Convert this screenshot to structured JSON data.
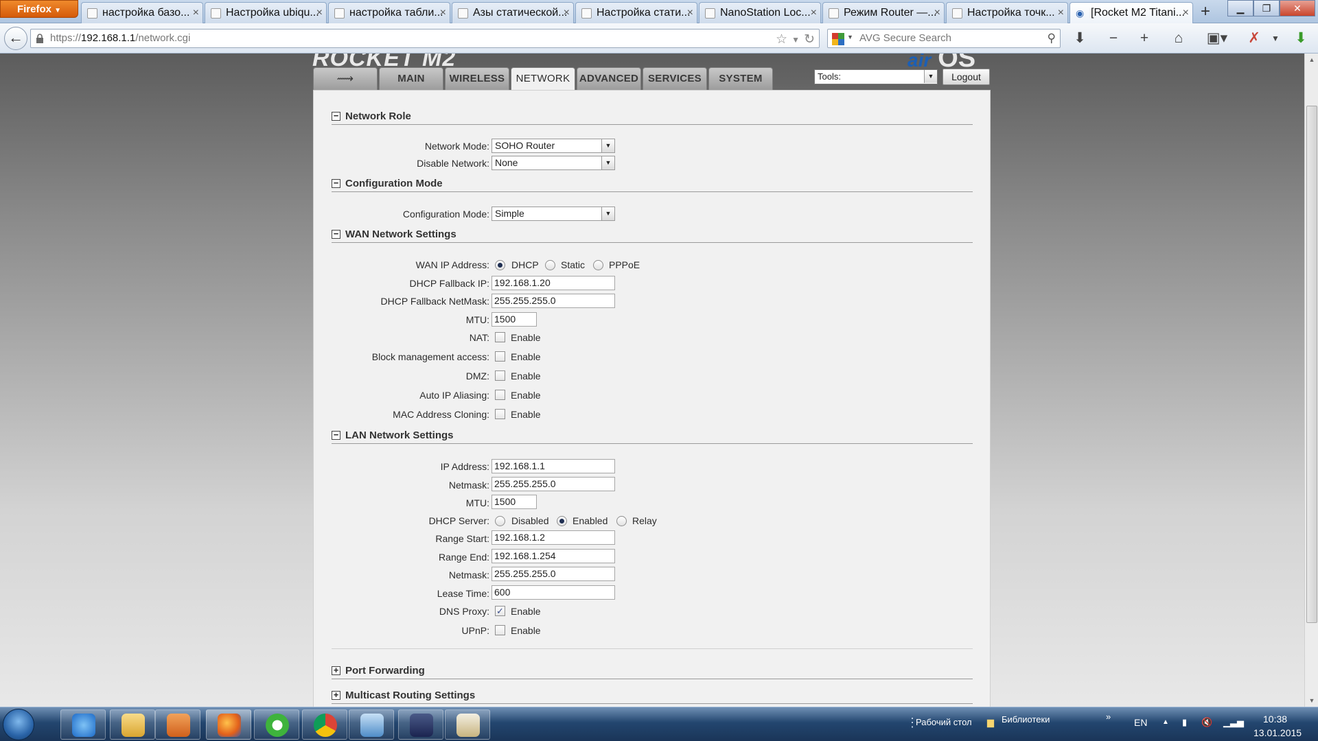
{
  "browser": {
    "menu_button": "Firefox",
    "tabs": [
      {
        "label": "настройка базо..."
      },
      {
        "label": "Настройка ubiqu..."
      },
      {
        "label": "настройка табли..."
      },
      {
        "label": "Азы статической..."
      },
      {
        "label": "Настройка стати..."
      },
      {
        "label": "NanoStation Loc..."
      },
      {
        "label": "Режим Router —..."
      },
      {
        "label": "Настройка точк..."
      },
      {
        "label": "[Rocket M2 Titani..."
      }
    ],
    "url_prefix": "https://",
    "url_host": "192.168.1.1",
    "url_path": "/network.cgi",
    "search_placeholder": "AVG Secure Search"
  },
  "page": {
    "nav_tabs": [
      "MAIN",
      "WIRELESS",
      "NETWORK",
      "ADVANCED",
      "SERVICES",
      "SYSTEM"
    ],
    "active_tab": "NETWORK",
    "tools_select": "Tools:",
    "logout": "Logout",
    "sections": {
      "network_role": "Network Role",
      "configuration_mode": "Configuration Mode",
      "wan": "WAN Network Settings",
      "lan": "LAN Network Settings",
      "port_forwarding": "Port Forwarding",
      "multicast": "Multicast Routing Settings"
    },
    "network_role": {
      "network_mode_label": "Network Mode:",
      "network_mode_value": "SOHO Router",
      "disable_network_label": "Disable Network:",
      "disable_network_value": "None"
    },
    "config": {
      "label": "Configuration Mode:",
      "value": "Simple"
    },
    "wan": {
      "ip_label": "WAN IP Address:",
      "ip_options": [
        "DHCP",
        "Static",
        "PPPoE"
      ],
      "ip_selected": "DHCP",
      "fallback_ip_label": "DHCP Fallback IP:",
      "fallback_ip": "192.168.1.20",
      "fallback_mask_label": "DHCP Fallback NetMask:",
      "fallback_mask": "255.255.255.0",
      "mtu_label": "MTU:",
      "mtu": "1500",
      "checks": [
        {
          "label": "NAT:",
          "text": "Enable",
          "checked": false
        },
        {
          "label": "Block management access:",
          "text": "Enable",
          "checked": false
        },
        {
          "label": "DMZ:",
          "text": "Enable",
          "checked": false
        },
        {
          "label": "Auto IP Aliasing:",
          "text": "Enable",
          "checked": false
        },
        {
          "label": "MAC Address Cloning:",
          "text": "Enable",
          "checked": false
        }
      ]
    },
    "lan": {
      "ip_label": "IP Address:",
      "ip": "192.168.1.1",
      "mask_label": "Netmask:",
      "mask": "255.255.255.0",
      "mtu_label": "MTU:",
      "mtu": "1500",
      "dhcp_label": "DHCP Server:",
      "dhcp_options": [
        "Disabled",
        "Enabled",
        "Relay"
      ],
      "dhcp_selected": "Enabled",
      "range_start_label": "Range Start:",
      "range_start": "192.168.1.2",
      "range_end_label": "Range End:",
      "range_end": "192.168.1.254",
      "netmask2_label": "Netmask:",
      "netmask2": "255.255.255.0",
      "lease_label": "Lease Time:",
      "lease": "600",
      "dns_label": "DNS Proxy:",
      "dns_text": "Enable",
      "dns_checked": true,
      "upnp_label": "UPnP:",
      "upnp_text": "Enable",
      "upnp_checked": false
    }
  },
  "taskbar": {
    "desktop_label": "Рабочий стол",
    "libraries_label": "Библиотеки",
    "lang": "EN",
    "time": "10:38",
    "date": "13.01.2015"
  }
}
